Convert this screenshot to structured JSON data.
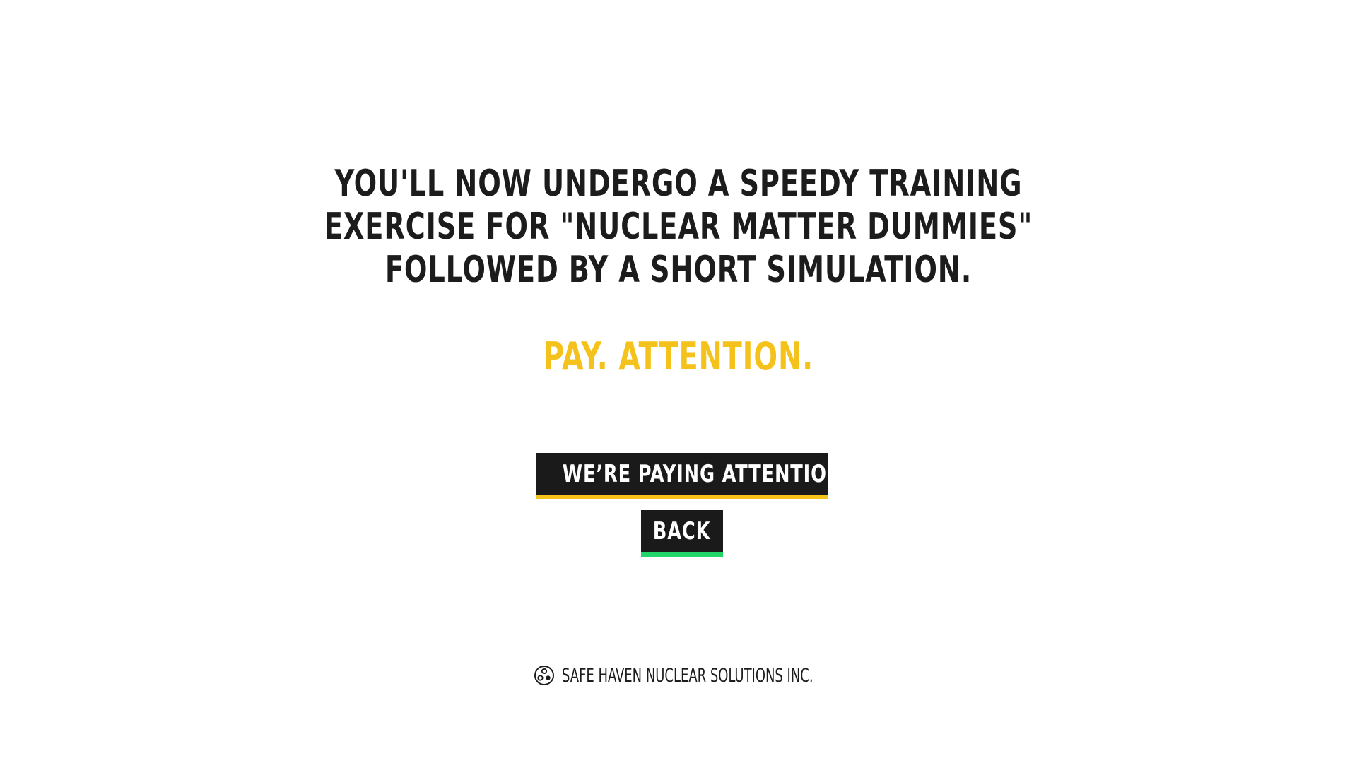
{
  "intro": {
    "lines": [
      "YOU'LL NOW UNDERGO A SPEEDY TRAINING",
      "EXERCISE FOR \"NUCLEAR MATTER DUMMIES\"",
      "FOLLOWED BY A SHORT SIMULATION."
    ]
  },
  "attention": "PAY. ATTENTION.",
  "buttons": {
    "primary_label": "WE’RE PAYING ATTENTION",
    "back_label": "BACK"
  },
  "footer": {
    "company": "SAFE HAVEN NUCLEAR SOLUTIONS INC.",
    "icon": "radiation-logo-icon"
  },
  "colors": {
    "text": "#1c1c1c",
    "accent_yellow": "#f5c21b",
    "accent_green": "#22d66a",
    "button_bg": "#1a1a1a",
    "background": "#ffffff"
  }
}
